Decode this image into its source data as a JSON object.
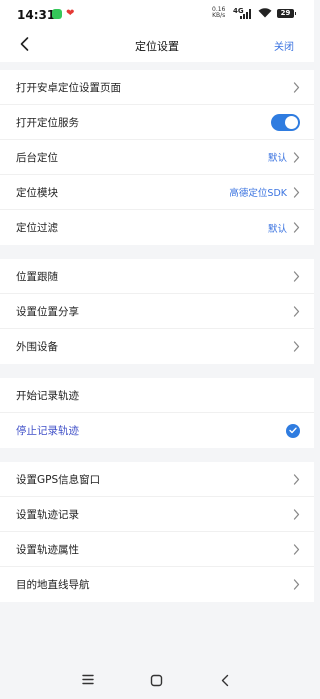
{
  "status_bar": {
    "time": "14:31",
    "net_speed_value": "0.16",
    "net_speed_unit": "KB/s",
    "network_type": "4G",
    "battery": "29"
  },
  "header": {
    "title": "定位设置",
    "close_label": "关闭"
  },
  "sections": [
    {
      "rows": [
        {
          "label": "打开安卓定位设置页面",
          "value": "",
          "control": "chevron"
        },
        {
          "label": "打开定位服务",
          "value": "",
          "control": "toggle-on"
        },
        {
          "label": "后台定位",
          "value": "默认",
          "control": "chevron"
        },
        {
          "label": "定位模块",
          "value": "高德定位SDK",
          "control": "chevron"
        },
        {
          "label": "定位过滤",
          "value": "默认",
          "control": "chevron"
        }
      ]
    },
    {
      "rows": [
        {
          "label": "位置跟随",
          "value": "",
          "control": "chevron"
        },
        {
          "label": "设置位置分享",
          "value": "",
          "control": "chevron"
        },
        {
          "label": "外围设备",
          "value": "",
          "control": "chevron"
        }
      ]
    },
    {
      "rows": [
        {
          "label": "开始记录轨迹",
          "value": "",
          "control": "none"
        },
        {
          "label": "停止记录轨迹",
          "value": "",
          "control": "check",
          "active": true
        }
      ]
    },
    {
      "rows": [
        {
          "label": "设置GPS信息窗口",
          "value": "",
          "control": "chevron"
        },
        {
          "label": "设置轨迹记录",
          "value": "",
          "control": "chevron"
        },
        {
          "label": "设置轨迹属性",
          "value": "",
          "control": "chevron"
        },
        {
          "label": "目的地直线导航",
          "value": "",
          "control": "chevron"
        }
      ]
    }
  ],
  "colors": {
    "accent": "#2f7ce0",
    "link": "#3a73e0",
    "active_text": "#4050c8",
    "background": "#f4f5f7"
  }
}
